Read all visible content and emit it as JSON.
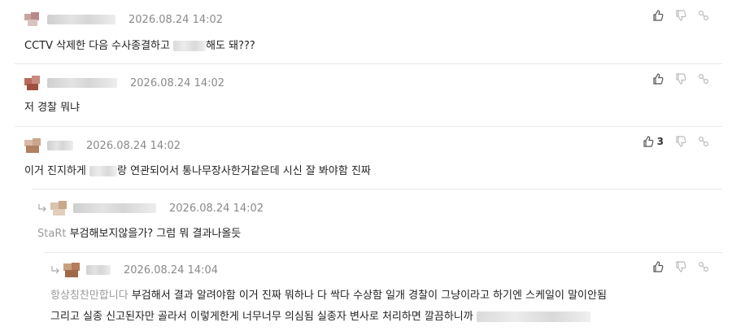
{
  "comments": [
    {
      "time": "2026.08.24 14:02",
      "text_before": "CCTV 삭제한 다음 수사종결하고 ",
      "text_after": "해도 돼???",
      "likes": ""
    },
    {
      "time": "2026.08.24 14:02",
      "text": "저 경찰 뭐냐",
      "likes": ""
    },
    {
      "time": "2026.08.24 14:02",
      "text_before": "이거 진지하게 ",
      "text_after": "랑 연관되어서 통나무장사한거같은데 시신 잘 봐야함 진짜",
      "likes": "3"
    },
    {
      "time": "2026.08.24 14:02",
      "mention": "StaRt",
      "text": "부검해보지않을가? 그럼 뭐 결과나올듯",
      "likes": ""
    },
    {
      "time": "2026.08.24 14:04",
      "mention": "항상칭찬만합니다",
      "line1": "부검해서 결과 알려야함 이거 진짜 뭐하나 다 싹다 수상함 일개 경찰이 그냥이라고 하기엔 스케일이 말이안됨",
      "line2": "그리고 실종 신고된자만 골라서 이렇게한게 너무너무 의심됨 실종자 변사로 처리하면 깔끔하니까 ",
      "likes": ""
    }
  ],
  "icons": {
    "like": "thumbs-up-icon",
    "dislike": "thumbs-down-icon",
    "share": "link-icon",
    "reply": "reply-arrow-icon"
  }
}
